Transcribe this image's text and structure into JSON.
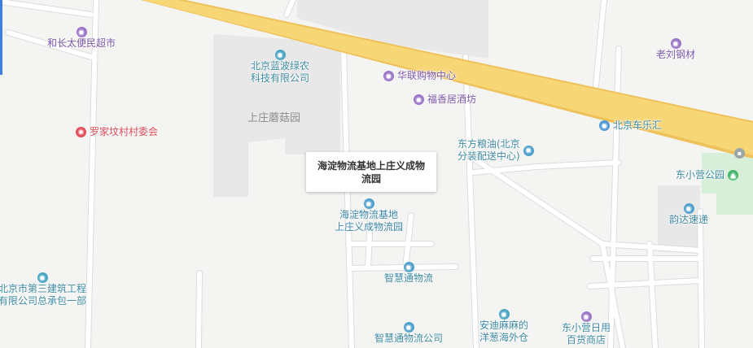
{
  "map": {
    "colors": {
      "background": "#f4f4f2",
      "highway": "#f7d676",
      "highway_edge": "#eec15a",
      "block": "#e8e8e8",
      "park": "#d7efd9",
      "road": "#ffffff",
      "road_edge": "#dcdcdc"
    },
    "selected_tooltip": {
      "lines": [
        "海淀物流基地上庄义成物",
        "流园"
      ]
    },
    "pois": {
      "hezhangtai": {
        "label": "和长太便民超市",
        "icon": "shop-icon"
      },
      "lanbo": {
        "lines": [
          "北京蓝波绿农",
          "科技有限公司"
        ],
        "icon": "company-icon"
      },
      "mogu_area": {
        "label": "上庄蘑菇园"
      },
      "hualian": {
        "label": "华联购物中心",
        "icon": "shop-icon"
      },
      "fuxiangju": {
        "label": "福香居酒坊",
        "icon": "shop-icon"
      },
      "laoliu": {
        "label": "老刘钢材",
        "icon": "shop-icon"
      },
      "luojiafen": {
        "label": "罗家坟村村委会",
        "icon": "government-icon"
      },
      "chelehui": {
        "label": "北京车乐汇",
        "icon": "car-icon"
      },
      "dongfang": {
        "lines": [
          "东方粮油(北京",
          "分装配送中心)"
        ],
        "icon": "logistics-icon"
      },
      "dongxiaoying_park": {
        "label": "东小营公园",
        "icon": "park-icon"
      },
      "yunda": {
        "label": "韵达速递",
        "icon": "logistics-icon"
      },
      "haidian_wuliu": {
        "lines": [
          "海淀物流基地",
          "上庄义成物流园"
        ],
        "icon": "logistics-icon"
      },
      "sanjian": {
        "lines": [
          "北京市第三建筑工程",
          "有限公司总承包一部"
        ],
        "icon": "company-icon"
      },
      "zhihuitong": {
        "label": "智慧通物流",
        "icon": "logistics-icon"
      },
      "zhihuitong_co": {
        "label": "智慧通物流公司",
        "icon": "logistics-icon"
      },
      "andi": {
        "lines": [
          "安迪麻麻的",
          "洋葱海外仓"
        ],
        "icon": "company-icon"
      },
      "dongxiaoying_store": {
        "lines": [
          "东小营日用",
          "百货商店"
        ],
        "icon": "shop-icon"
      }
    }
  }
}
